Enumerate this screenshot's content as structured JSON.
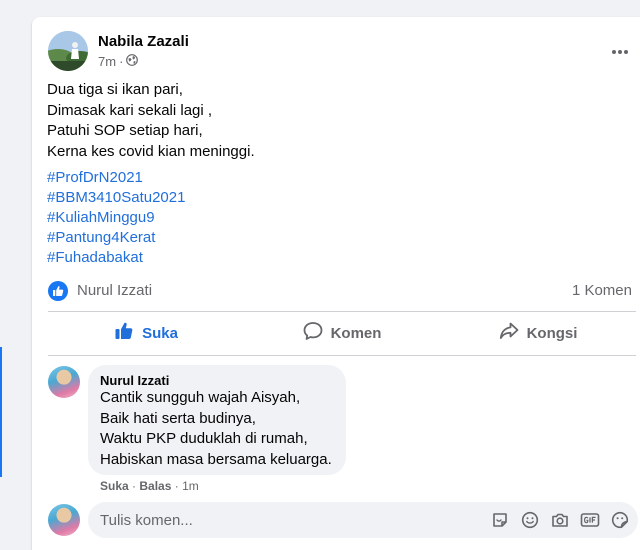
{
  "post": {
    "author": "Nabila Zazali",
    "time": "7m",
    "separator": "·",
    "privacy_icon": "globe-icon",
    "more_icon": "more-horizontal-icon",
    "text_lines": [
      "Dua tiga si ikan pari,",
      "Dimasak kari sekali lagi ,",
      "Patuhi SOP setiap hari,",
      "Kerna kes covid kian meninggi."
    ],
    "hashtags": [
      "#ProfDrN2021",
      "#BBM3410Satu2021",
      "#KuliahMinggu9",
      "#Pantung4Kerat",
      "#Fuhadabakat"
    ]
  },
  "reactions": {
    "icon": "like-reaction-icon",
    "reactor": "Nurul Izzati",
    "comment_count": "1 Komen"
  },
  "actions": {
    "like": "Suka",
    "comment": "Komen",
    "share": "Kongsi"
  },
  "comment": {
    "author": "Nurul Izzati",
    "lines": [
      "Cantik sungguh wajah Aisyah,",
      "Baik hati serta budinya,",
      "Waktu PKP duduklah di rumah,",
      "Habiskan masa bersama keluarga."
    ],
    "like_label": "Suka",
    "reply_label": "Balas",
    "dot": "·",
    "time": "1m"
  },
  "composer": {
    "placeholder": "Tulis komen...",
    "icons": [
      "sticker-icon",
      "emoji-icon",
      "camera-icon",
      "gif-icon",
      "sticker-face-icon"
    ]
  },
  "colors": {
    "accent": "#216fdb",
    "like_blue": "#1877f2",
    "secondary_text": "#65676b",
    "page_bg": "#f0f2f5"
  }
}
